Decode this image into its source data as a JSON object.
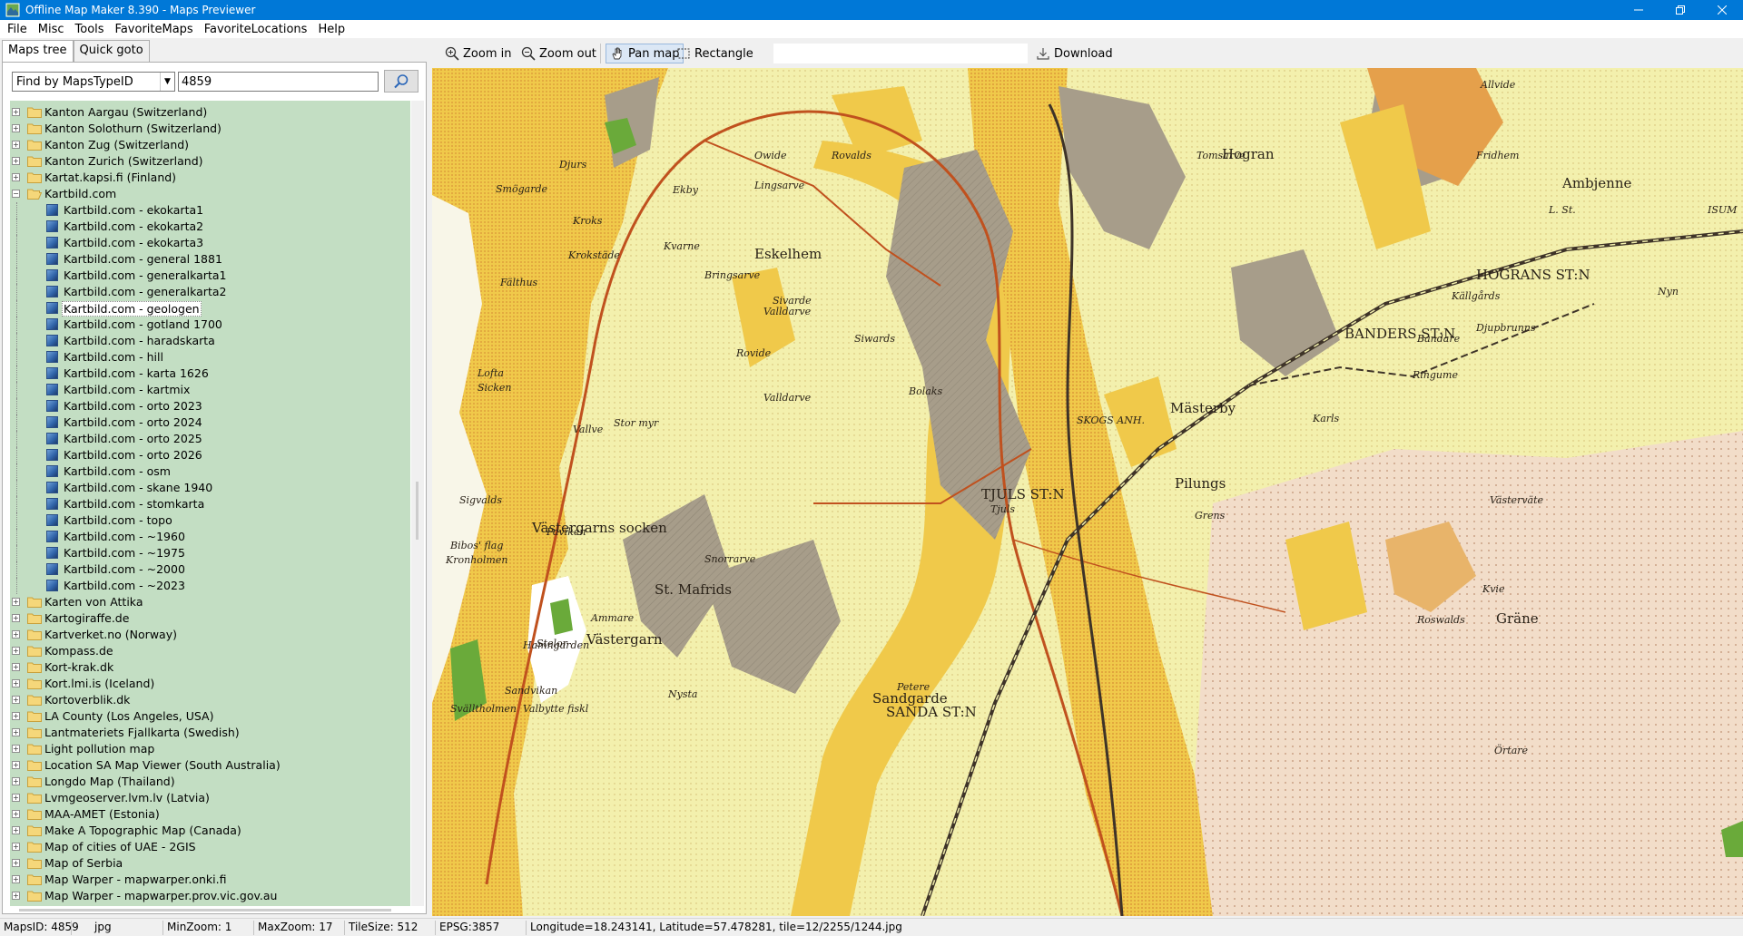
{
  "window": {
    "title": "Offline Map Maker 8.390 - Maps Previewer"
  },
  "menu": [
    "File",
    "Misc",
    "Tools",
    "FavoriteMaps",
    "FavoriteLocations",
    "Help"
  ],
  "left_panel": {
    "tabs": [
      {
        "label": "Maps tree",
        "active": true
      },
      {
        "label": "Quick goto",
        "active": false
      }
    ],
    "find": {
      "mode": "Find by MapsTypeID",
      "value": "4859"
    },
    "tree": [
      {
        "label": "Kanton Aargau (Switzerland)",
        "level": 0,
        "expanded": false
      },
      {
        "label": "Kanton Solothurn (Switzerland)",
        "level": 0,
        "expanded": false
      },
      {
        "label": "Kanton Zug (Switzerland)",
        "level": 0,
        "expanded": false
      },
      {
        "label": "Kanton Zurich (Switzerland)",
        "level": 0,
        "expanded": false
      },
      {
        "label": "Kartat.kapsi.fi (Finland)",
        "level": 0,
        "expanded": false
      },
      {
        "label": "Kartbild.com",
        "level": 0,
        "expanded": true
      },
      {
        "label": "Kartbild.com - ekokarta1",
        "level": 1
      },
      {
        "label": "Kartbild.com - ekokarta2",
        "level": 1
      },
      {
        "label": "Kartbild.com - ekokarta3",
        "level": 1
      },
      {
        "label": "Kartbild.com - general 1881",
        "level": 1
      },
      {
        "label": "Kartbild.com - generalkarta1",
        "level": 1
      },
      {
        "label": "Kartbild.com - generalkarta2",
        "level": 1
      },
      {
        "label": "Kartbild.com - geologen",
        "level": 1,
        "selected": true
      },
      {
        "label": "Kartbild.com - gotland 1700",
        "level": 1
      },
      {
        "label": "Kartbild.com - haradskarta",
        "level": 1
      },
      {
        "label": "Kartbild.com - hill",
        "level": 1
      },
      {
        "label": "Kartbild.com - karta 1626",
        "level": 1
      },
      {
        "label": "Kartbild.com - kartmix",
        "level": 1
      },
      {
        "label": "Kartbild.com - orto 2023",
        "level": 1
      },
      {
        "label": "Kartbild.com - orto 2024",
        "level": 1
      },
      {
        "label": "Kartbild.com - orto 2025",
        "level": 1
      },
      {
        "label": "Kartbild.com - orto 2026",
        "level": 1
      },
      {
        "label": "Kartbild.com - osm",
        "level": 1
      },
      {
        "label": "Kartbild.com - skane 1940",
        "level": 1
      },
      {
        "label": "Kartbild.com - stomkarta",
        "level": 1
      },
      {
        "label": "Kartbild.com - topo",
        "level": 1
      },
      {
        "label": "Kartbild.com - ~1960",
        "level": 1
      },
      {
        "label": "Kartbild.com - ~1975",
        "level": 1
      },
      {
        "label": "Kartbild.com - ~2000",
        "level": 1
      },
      {
        "label": "Kartbild.com - ~2023",
        "level": 1
      },
      {
        "label": "Karten von Attika",
        "level": 0,
        "expanded": false
      },
      {
        "label": "Kartogiraffe.de",
        "level": 0,
        "expanded": false
      },
      {
        "label": "Kartverket.no (Norway)",
        "level": 0,
        "expanded": false
      },
      {
        "label": "Kompass.de",
        "level": 0,
        "expanded": false
      },
      {
        "label": "Kort-krak.dk",
        "level": 0,
        "expanded": false
      },
      {
        "label": "Kort.lmi.is (Iceland)",
        "level": 0,
        "expanded": false
      },
      {
        "label": "Kortoverblik.dk",
        "level": 0,
        "expanded": false
      },
      {
        "label": "LA County (Los Angeles, USA)",
        "level": 0,
        "expanded": false
      },
      {
        "label": "Lantmateriets Fjallkarta (Swedish)",
        "level": 0,
        "expanded": false
      },
      {
        "label": "Light pollution map",
        "level": 0,
        "expanded": false
      },
      {
        "label": "Location SA Map Viewer (South Australia)",
        "level": 0,
        "expanded": false
      },
      {
        "label": "Longdo Map (Thailand)",
        "level": 0,
        "expanded": false
      },
      {
        "label": "Lvmgeoserver.lvm.lv (Latvia)",
        "level": 0,
        "expanded": false
      },
      {
        "label": "MAA-AMET (Estonia)",
        "level": 0,
        "expanded": false
      },
      {
        "label": "Make A Topographic Map (Canada)",
        "level": 0,
        "expanded": false
      },
      {
        "label": "Map of cities of UAE - 2GIS",
        "level": 0,
        "expanded": false
      },
      {
        "label": "Map of Serbia",
        "level": 0,
        "expanded": false
      },
      {
        "label": "Map Warper - mapwarper.onki.fi",
        "level": 0,
        "expanded": false
      },
      {
        "label": "Map Warper - mapwarper.prov.vic.gov.au",
        "level": 0,
        "expanded": false
      }
    ]
  },
  "toolbar": {
    "zoom_in": "Zoom in",
    "zoom_out": "Zoom out",
    "pan_map": "Pan map",
    "rectangle": "Rectangle",
    "download": "Download",
    "active_tool": "Pan map"
  },
  "map_labels": [
    "Allvide",
    "Owide",
    "Rovalds",
    "Tomsarve",
    "Hogran",
    "Smögarde",
    "Lingsarve",
    "Kroks",
    "Djurs",
    "Ekby",
    "Ambjenne",
    "L. St.",
    "Kvarne",
    "Krokstäde",
    "Bringsarve",
    "Eskelhem",
    "HOGRANS ST:N",
    "Källgårds",
    "Sivarde",
    "Valldarve",
    "BANDERS ST:N",
    "Bandare",
    "Ringume",
    "Djupbrunns",
    "Siwards",
    "Bolaks",
    "Rovide",
    "Stor myr",
    "SKOGS ANH.",
    "Mästerby",
    "Karls",
    "Valldarve",
    "Västergarns socken",
    "Paviken",
    "TJULS ST:N",
    "Tjuls",
    "Pilungs",
    "Västerväte",
    "Kronholmen",
    "Snorrarve",
    "St. Mafrids",
    "Västergarn",
    "Sandgarde",
    "SANDA ST:N",
    "Kvie",
    "Gräne",
    "Hamngarden",
    "Nysta",
    "Petere",
    "Örtare",
    "Roswalds",
    "Grens",
    "Stelor",
    "Ammare",
    "Lofta",
    "Sicken",
    "Vallve",
    "Fälthus",
    "Sigvalds",
    "Nyn",
    "Valbytte fiskl",
    "Sandvikan",
    "Svälltholmen",
    "Bibos' flag",
    "Fridhem",
    "ISUM"
  ],
  "statusbar": {
    "maps_id": "MapsID: 4859",
    "format": "jpg",
    "min_zoom": "MinZoom: 1",
    "max_zoom": "MaxZoom: 17",
    "tile_size": "TileSize: 512",
    "epsg": "EPSG:3857",
    "coords": "Longitude=18.243141, Latitude=57.478281, tile=12/2255/1244.jpg"
  },
  "colors": {
    "titlebar": "#0078d7",
    "tree_background": "#c3dec3",
    "map_paper": "#f3f0ad",
    "map_sand": "#f0c94a",
    "map_grey": "#a79d8a",
    "map_pink": "#f2ddc9",
    "map_rail": "#5a4a3a",
    "map_road": "#c0511e"
  }
}
